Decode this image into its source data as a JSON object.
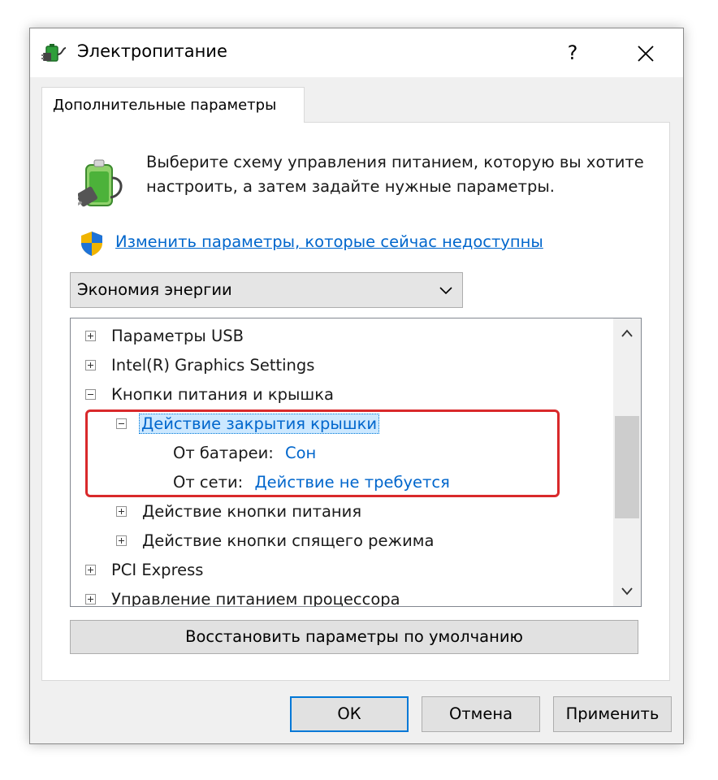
{
  "window": {
    "title": "Электропитание",
    "help_label": "?",
    "icon": "power-options-icon"
  },
  "tab": {
    "label": "Дополнительные параметры"
  },
  "description": "Выберите схему управления питанием, которую вы хотите настроить, а затем задайте нужные параметры.",
  "change_link": "Изменить параметры, которые сейчас недоступны",
  "plan_select": {
    "value": "Экономия энергии"
  },
  "tree": {
    "items": [
      {
        "label": "Параметры USB",
        "state": "collapsed"
      },
      {
        "label": "Intel(R) Graphics Settings",
        "state": "collapsed"
      },
      {
        "label": "Кнопки питания и крышка",
        "state": "expanded"
      },
      {
        "label": "Действие закрытия крышки",
        "state": "expanded",
        "selected": true
      },
      {
        "label": "От батареи:",
        "value": "Сон"
      },
      {
        "label": "От сети:",
        "value": "Действие не требуется"
      },
      {
        "label": "Действие кнопки питания",
        "state": "collapsed"
      },
      {
        "label": "Действие кнопки спящего режима",
        "state": "collapsed"
      },
      {
        "label": "PCI Express",
        "state": "collapsed"
      },
      {
        "label": "Управление питанием процессора",
        "state": "collapsed"
      }
    ]
  },
  "restore_button": "Восстановить параметры по умолчанию",
  "buttons": {
    "ok": "ОК",
    "cancel": "Отмена",
    "apply": "Применить"
  },
  "colors": {
    "link": "#0066cc",
    "highlight": "#d9292b",
    "selection": "#cce8ff",
    "focus": "#0078d7"
  }
}
